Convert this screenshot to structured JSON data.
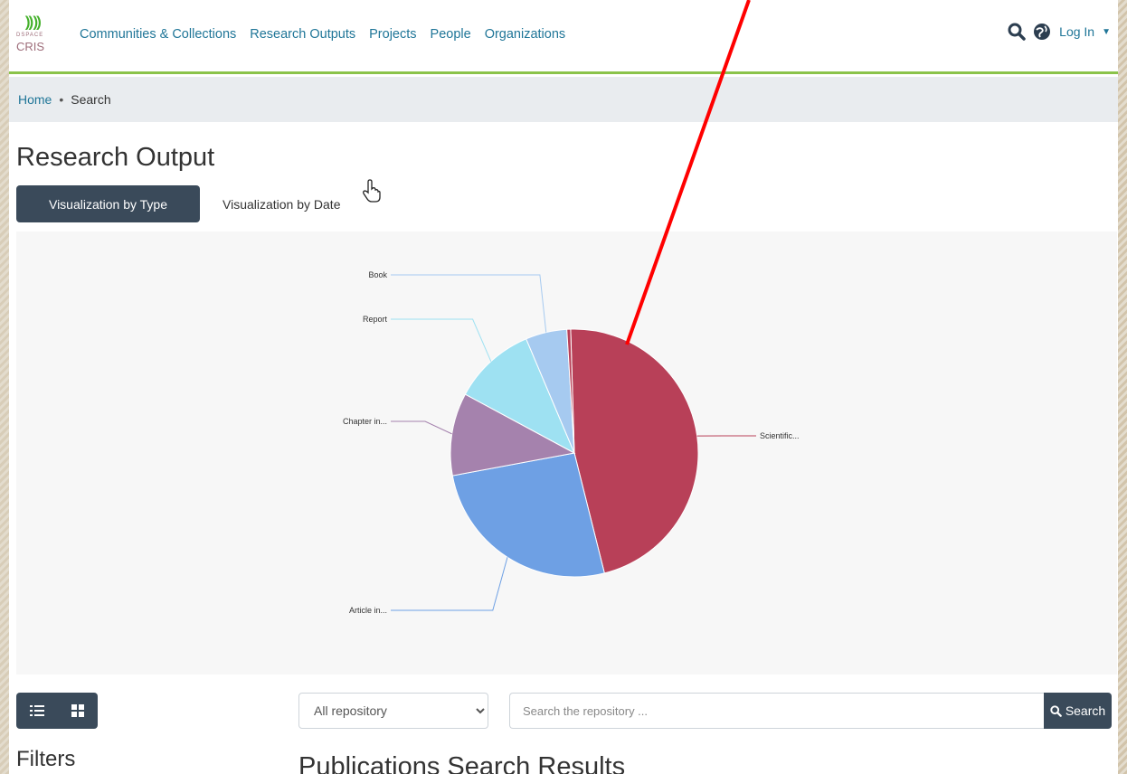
{
  "logo": {
    "mark": "⸩⸩",
    "small": "DSPACE",
    "name": "CRIS"
  },
  "nav": {
    "items": [
      "Communities & Collections",
      "Research Outputs",
      "Projects",
      "People",
      "Organizations"
    ],
    "login_label": "Log In"
  },
  "breadcrumb": {
    "home": "Home",
    "separator": "•",
    "current": "Search"
  },
  "page": {
    "title": "Research Output",
    "tabs": [
      {
        "label": "Visualization by Type",
        "active": true
      },
      {
        "label": "Visualization by Date",
        "active": false
      }
    ]
  },
  "chart_data": {
    "type": "pie",
    "labels": [
      "Scientific...",
      "Article in...",
      "Chapter in...",
      "Report",
      "Book",
      ""
    ],
    "values": [
      47.5,
      26.5,
      11,
      11,
      5.5,
      0.5
    ],
    "colors": [
      "#b84058",
      "#6ea0e4",
      "#a582ad",
      "#9ee1f2",
      "#a6caf0",
      "#b84058"
    ]
  },
  "toolbar": {
    "scope_options": [
      "All repository"
    ],
    "search_placeholder": "Search the repository ...",
    "search_button": "Search"
  },
  "sections": {
    "filters": "Filters",
    "results": "Publications Search Results"
  },
  "colors": {
    "accent_dark": "#3a4a5a",
    "link": "#207698",
    "header_border": "#8bc34a",
    "annotation": "#ff0000"
  },
  "icons": [
    "search-icon",
    "globe-icon",
    "list-view-icon",
    "grid-view-icon",
    "hand-cursor-icon"
  ]
}
